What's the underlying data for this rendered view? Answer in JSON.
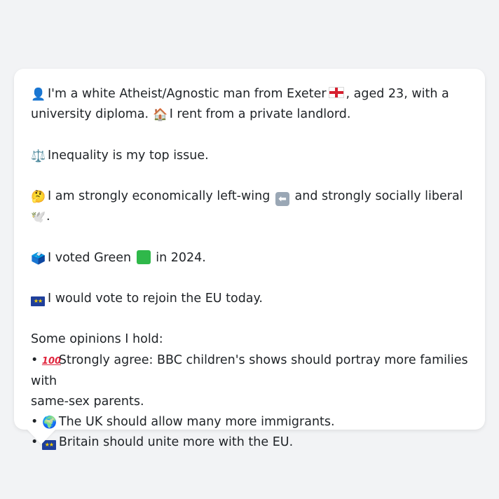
{
  "lines": {
    "l1": "I'm a white Atheist/Agnostic man from Exeter",
    "l1b": ", aged 23, with a",
    "l2a": "university diploma.",
    "l2b": "I rent from a private landlord.",
    "l3": "Inequality is my top issue.",
    "l4a": "I am strongly economically left-wing",
    "l4b": "and strongly socially liberal",
    "l4c": ".",
    "l5a": "I voted Green",
    "l5b": "in 2024.",
    "l6": "I would vote to rejoin the EU today.",
    "l7": "Some opinions I hold:",
    "b1a": "Strongly agree: BBC children's shows should portray more families with",
    "b1b": "same-sex parents.",
    "b2": "The UK should allow many more immigrants.",
    "b3": "Britain should unite more with the EU."
  },
  "bullet": "•",
  "icons": {
    "person": "👤",
    "house": "🏠",
    "scales": "⚖️",
    "thinking": "🤔",
    "dove": "🕊️",
    "ballot": "🗳️",
    "globe": "🌍",
    "stars": "★★"
  },
  "colors": {
    "green_swatch": "#2fb84a",
    "background": "#f2f3f5",
    "card": "#ffffff"
  }
}
